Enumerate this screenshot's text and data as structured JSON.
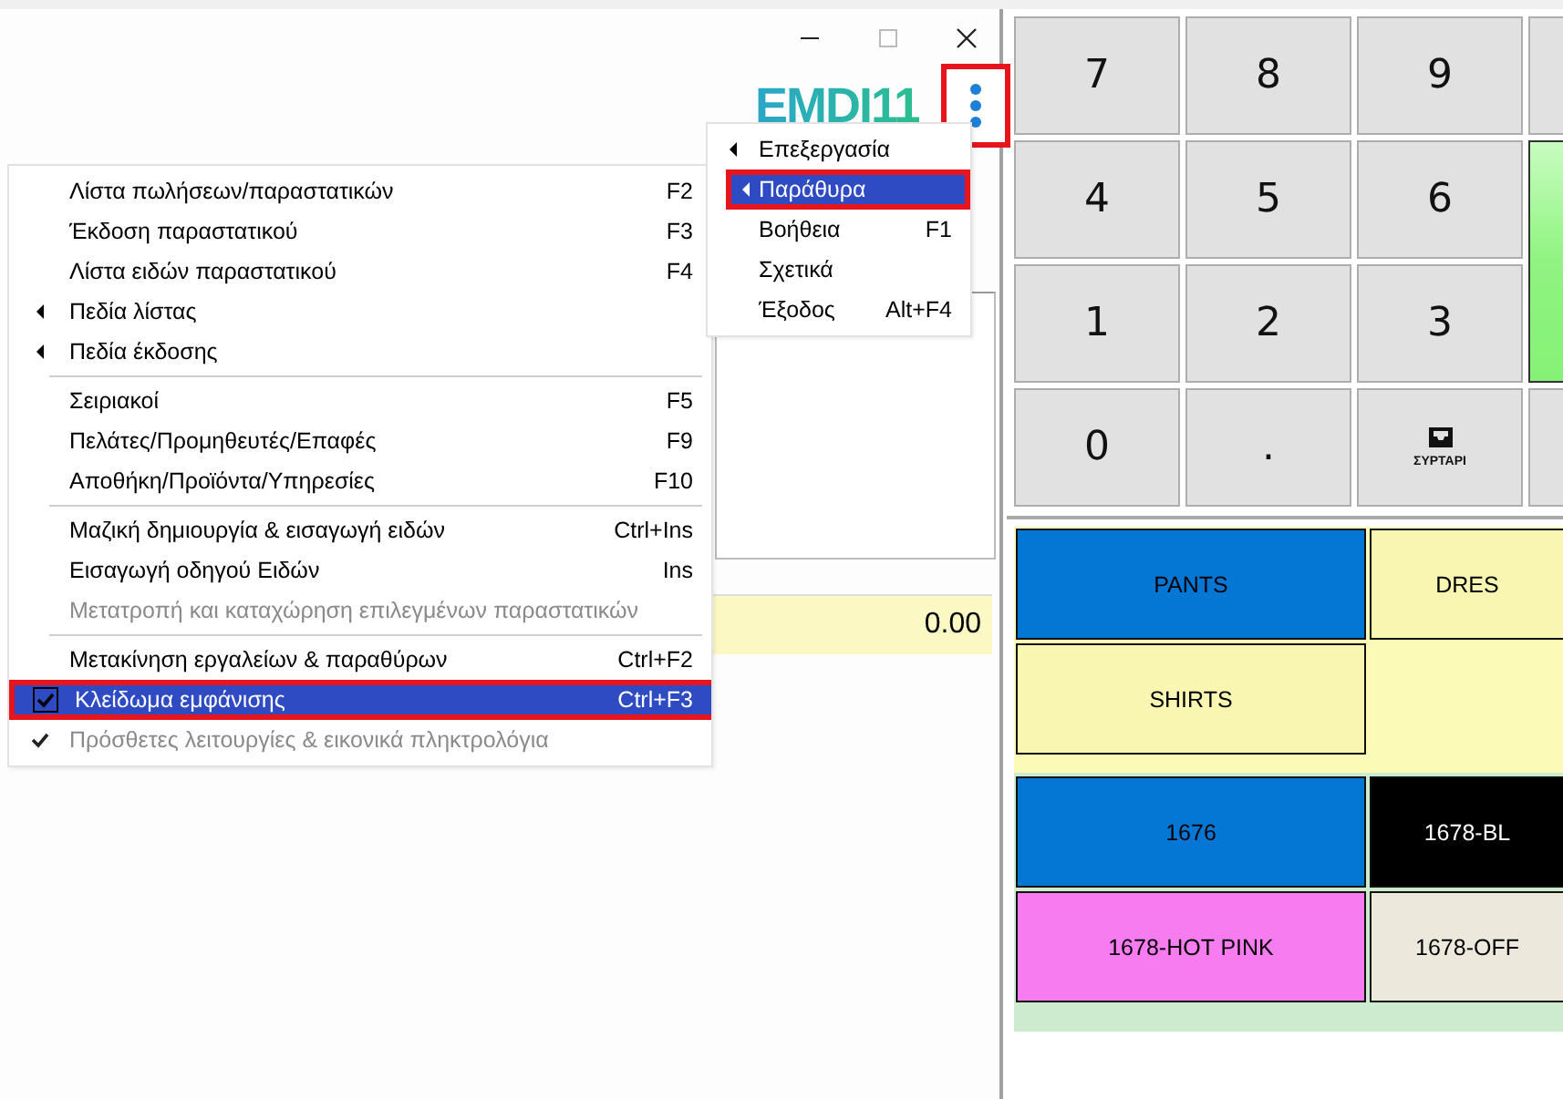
{
  "window": {
    "logo": "EMDI11",
    "menu_button": {
      "highlighted": true
    }
  },
  "panel": {
    "total": "0.00"
  },
  "submenu": [
    {
      "label": "Επεξεργασία",
      "submenu": true,
      "selected": false,
      "highlighted": false
    },
    {
      "label": "Παράθυρα",
      "submenu": true,
      "selected": true,
      "highlighted": true
    },
    {
      "label": "Βοήθεια",
      "shortcut": "F1",
      "submenu": false,
      "selected": false,
      "highlighted": false
    },
    {
      "label": "Σχετικά",
      "submenu": false,
      "selected": false,
      "highlighted": false
    },
    {
      "label": "Έξοδος",
      "shortcut": "Alt+F4",
      "submenu": false,
      "selected": false,
      "highlighted": false
    }
  ],
  "menu": [
    {
      "kind": "item",
      "label": "Λίστα πωλήσεων/παραστατικών",
      "shortcut": "F2",
      "submenu": false,
      "checked": false,
      "disabled": false,
      "selected": false,
      "highlighted": false
    },
    {
      "kind": "item",
      "label": "Έκδοση παραστατικού",
      "shortcut": "F3",
      "submenu": false,
      "checked": false,
      "disabled": false,
      "selected": false,
      "highlighted": false
    },
    {
      "kind": "item",
      "label": "Λίστα ειδών παραστατικού",
      "shortcut": "F4",
      "submenu": false,
      "checked": false,
      "disabled": false,
      "selected": false,
      "highlighted": false
    },
    {
      "kind": "item",
      "label": "Πεδία λίστας",
      "submenu": true,
      "checked": false,
      "disabled": false,
      "selected": false,
      "highlighted": false
    },
    {
      "kind": "item",
      "label": "Πεδία έκδοσης",
      "submenu": true,
      "checked": false,
      "disabled": false,
      "selected": false,
      "highlighted": false
    },
    {
      "kind": "separator"
    },
    {
      "kind": "item",
      "label": "Σειριακοί",
      "shortcut": "F5",
      "submenu": false,
      "checked": false,
      "disabled": false,
      "selected": false,
      "highlighted": false
    },
    {
      "kind": "item",
      "label": "Πελάτες/Προμηθευτές/Επαφές",
      "shortcut": "F9",
      "submenu": false,
      "checked": false,
      "disabled": false,
      "selected": false,
      "highlighted": false
    },
    {
      "kind": "item",
      "label": "Αποθήκη/Προϊόντα/Υπηρεσίες",
      "shortcut": "F10",
      "submenu": false,
      "checked": false,
      "disabled": false,
      "selected": false,
      "highlighted": false
    },
    {
      "kind": "separator"
    },
    {
      "kind": "item",
      "label": "Μαζική δημιουργία & εισαγωγή ειδών",
      "shortcut": "Ctrl+Ins",
      "submenu": false,
      "checked": false,
      "disabled": false,
      "selected": false,
      "highlighted": false
    },
    {
      "kind": "item",
      "label": "Εισαγωγή οδηγού Ειδών",
      "shortcut": "Ins",
      "submenu": false,
      "checked": false,
      "disabled": false,
      "selected": false,
      "highlighted": false
    },
    {
      "kind": "item",
      "label": "Μετατροπή και καταχώρηση επιλεγμένων παραστατικών",
      "submenu": false,
      "checked": false,
      "disabled": true,
      "selected": false,
      "highlighted": false
    },
    {
      "kind": "separator"
    },
    {
      "kind": "item",
      "label": "Μετακίνηση εργαλείων & παραθύρων",
      "shortcut": "Ctrl+F2",
      "submenu": false,
      "checked": false,
      "disabled": false,
      "selected": false,
      "highlighted": false
    },
    {
      "kind": "item",
      "label": "Κλείδωμα εμφάνισης",
      "shortcut": "Ctrl+F3",
      "submenu": false,
      "checked": true,
      "disabled": false,
      "selected": true,
      "highlighted": true
    },
    {
      "kind": "item",
      "label": "Πρόσθετες λειτουργίες & εικονικά πληκτρολόγια",
      "submenu": false,
      "checked": true,
      "disabled": true,
      "selected": false,
      "highlighted": false
    }
  ],
  "keypad": [
    {
      "kind": "key",
      "label": "7"
    },
    {
      "kind": "key",
      "label": "8"
    },
    {
      "kind": "key",
      "label": "9"
    },
    {
      "kind": "blank"
    },
    {
      "kind": "key",
      "label": "4"
    },
    {
      "kind": "key",
      "label": "5"
    },
    {
      "kind": "key",
      "label": "6"
    },
    {
      "kind": "enter"
    },
    {
      "kind": "key",
      "label": "1"
    },
    {
      "kind": "key",
      "label": "2"
    },
    {
      "kind": "key",
      "label": "3"
    },
    {
      "kind": "key",
      "label": "0"
    },
    {
      "kind": "key",
      "label": "."
    },
    {
      "kind": "drawer",
      "label": "ΣΥΡΤΑΡΙ"
    },
    {
      "kind": "blank"
    }
  ],
  "categories": [
    [
      {
        "label": "PANTS",
        "color": "#0476d4"
      },
      {
        "label": "DRES",
        "color": "#f8f6b0"
      }
    ],
    [
      {
        "label": "SHIRTS",
        "color": "#f8f6b0"
      }
    ]
  ],
  "products": [
    [
      {
        "label": "1676",
        "color": "#0476d4"
      },
      {
        "label": "1678-BL",
        "color": "#000000"
      }
    ],
    [
      {
        "label": "1678-HOT PINK",
        "color": "#f77cf0"
      },
      {
        "label": "1678-OFF",
        "color": "#ece8dc"
      }
    ]
  ]
}
